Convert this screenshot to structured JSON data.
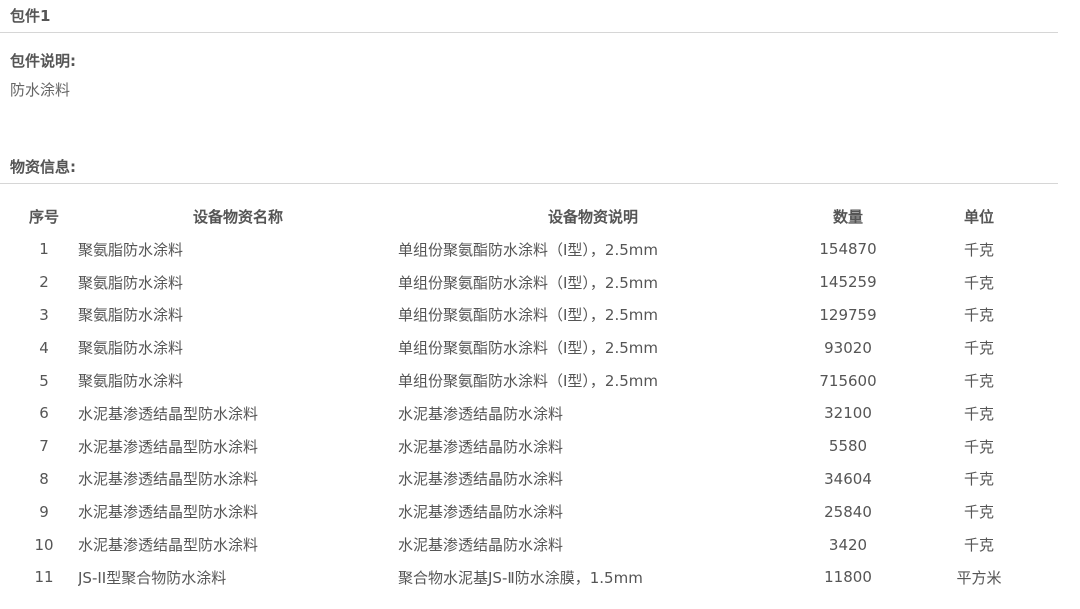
{
  "package": {
    "title": "包件1",
    "description_label": "包件说明:",
    "description": "防水涂料",
    "materials_label": "物资信息:"
  },
  "table": {
    "headers": {
      "seq": "序号",
      "name": "设备物资名称",
      "desc": "设备物资说明",
      "qty": "数量",
      "unit": "单位"
    },
    "rows": [
      {
        "seq": "1",
        "name": "聚氨脂防水涂料",
        "desc": "单组份聚氨酯防水涂料（I型），2.5mm",
        "qty": "154870",
        "unit": "千克"
      },
      {
        "seq": "2",
        "name": "聚氨脂防水涂料",
        "desc": "单组份聚氨酯防水涂料（I型），2.5mm",
        "qty": "145259",
        "unit": "千克"
      },
      {
        "seq": "3",
        "name": "聚氨脂防水涂料",
        "desc": "单组份聚氨酯防水涂料（I型），2.5mm",
        "qty": "129759",
        "unit": "千克"
      },
      {
        "seq": "4",
        "name": "聚氨脂防水涂料",
        "desc": "单组份聚氨酯防水涂料（I型），2.5mm",
        "qty": "93020",
        "unit": "千克"
      },
      {
        "seq": "5",
        "name": "聚氨脂防水涂料",
        "desc": "单组份聚氨酯防水涂料（I型），2.5mm",
        "qty": "715600",
        "unit": "千克"
      },
      {
        "seq": "6",
        "name": "水泥基渗透结晶型防水涂料",
        "desc": "水泥基渗透结晶防水涂料",
        "qty": "32100",
        "unit": "千克"
      },
      {
        "seq": "7",
        "name": "水泥基渗透结晶型防水涂料",
        "desc": "水泥基渗透结晶防水涂料",
        "qty": "5580",
        "unit": "千克"
      },
      {
        "seq": "8",
        "name": "水泥基渗透结晶型防水涂料",
        "desc": "水泥基渗透结晶防水涂料",
        "qty": "34604",
        "unit": "千克"
      },
      {
        "seq": "9",
        "name": "水泥基渗透结晶型防水涂料",
        "desc": "水泥基渗透结晶防水涂料",
        "qty": "25840",
        "unit": "千克"
      },
      {
        "seq": "10",
        "name": "水泥基渗透结晶型防水涂料",
        "desc": "水泥基渗透结晶防水涂料",
        "qty": "3420",
        "unit": "千克"
      },
      {
        "seq": "11",
        "name": "JS-II型聚合物防水涂料",
        "desc": "聚合物水泥基JS-Ⅱ防水涂膜，1.5mm",
        "qty": "11800",
        "unit": "平方米"
      }
    ]
  }
}
